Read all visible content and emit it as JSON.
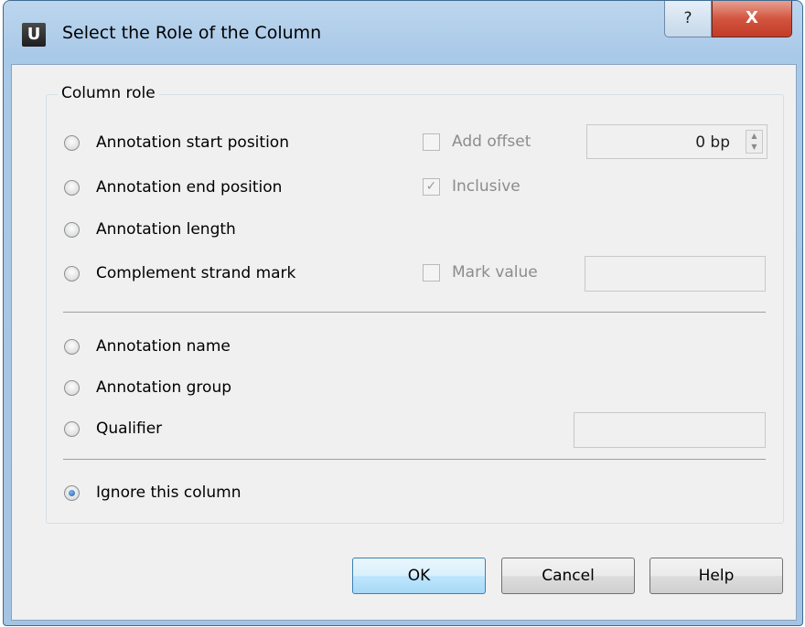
{
  "window": {
    "app_icon_letter": "U",
    "title": "Select the Role of the Column",
    "help_glyph": "?",
    "close_glyph": "X"
  },
  "group": {
    "title": "Column role",
    "options": [
      {
        "label": "Annotation start position",
        "selected": false
      },
      {
        "label": "Annotation end position",
        "selected": false
      },
      {
        "label": "Annotation length",
        "selected": false
      },
      {
        "label": "Complement strand mark",
        "selected": false
      },
      {
        "label": "Annotation name",
        "selected": false
      },
      {
        "label": "Annotation group",
        "selected": false
      },
      {
        "label": "Qualifier",
        "selected": false
      },
      {
        "label": "Ignore this column",
        "selected": true
      }
    ],
    "add_offset": {
      "label": "Add offset",
      "checked": false,
      "enabled": false
    },
    "offset_spinner": {
      "value": "0 bp",
      "enabled": false
    },
    "inclusive": {
      "label": "Inclusive",
      "checked": true,
      "enabled": false
    },
    "mark_value": {
      "label": "Mark value",
      "checked": false,
      "enabled": false
    },
    "mark_value_field": "",
    "qualifier_field": ""
  },
  "buttons": {
    "ok": "OK",
    "cancel": "Cancel",
    "help": "Help"
  }
}
